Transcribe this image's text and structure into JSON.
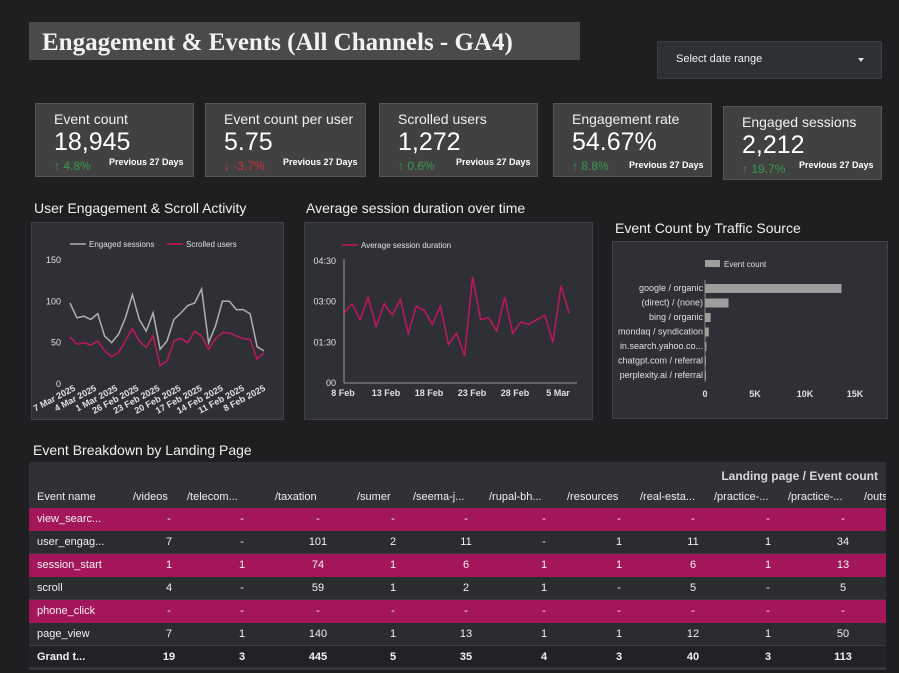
{
  "header": {
    "title": "Engagement & Events (All Channels - GA4)",
    "date_range_label": "Select date range"
  },
  "kpis": [
    {
      "label": "Event count",
      "value": "18,945",
      "delta": "4.8%",
      "direction": "up",
      "prev": "Previous 27 Days"
    },
    {
      "label": "Event count per user",
      "value": "5.75",
      "delta": "-3.7%",
      "direction": "down",
      "prev": "Previous 27 Days"
    },
    {
      "label": "Scrolled users",
      "value": "1,272",
      "delta": "0.6%",
      "direction": "up",
      "prev": "Previous 27 Days"
    },
    {
      "label": "Engagement rate",
      "value": "54.67%",
      "delta": "8.8%",
      "direction": "up",
      "prev": "Previous 27 Days"
    },
    {
      "label": "Engaged sessions",
      "value": "2,212",
      "delta": "19.7%",
      "direction": "up",
      "prev": "Previous 27 Days"
    }
  ],
  "colors": {
    "engaged": "#b0b0b0",
    "scrolled": "#c2185b",
    "up": "#3a9a4a",
    "down": "#d0303c",
    "bar": "#9e9e9e",
    "highlight_row": "#a3175a"
  },
  "chart_titles": {
    "engagement": "User Engagement & Scroll Activity",
    "duration": "Average session duration over time",
    "traffic": "Event Count by Traffic Source"
  },
  "chart_data": [
    {
      "type": "line",
      "title": "User Engagement & Scroll Activity",
      "x_tick_labels": [
        "7 Mar 2025",
        "4 Mar 2025",
        "1 Mar 2025",
        "26 Feb 2025",
        "23 Feb 2025",
        "20 Feb 2025",
        "17 Feb 2025",
        "14 Feb 2025",
        "11 Feb 2025",
        "8 Feb 2025"
      ],
      "ylim": [
        0,
        150
      ],
      "y_ticks": [
        "0",
        "50",
        "100",
        "150"
      ],
      "legend_position": "top",
      "series": [
        {
          "name": "Engaged sessions",
          "values": [
            98,
            80,
            82,
            78,
            85,
            58,
            50,
            60,
            80,
            108,
            78,
            64,
            86,
            42,
            52,
            78,
            86,
            95,
            98,
            115,
            50,
            70,
            100,
            100,
            90,
            90,
            85,
            45,
            40
          ]
        },
        {
          "name": "Scrolled users",
          "values": [
            57,
            48,
            50,
            47,
            52,
            40,
            33,
            38,
            52,
            67,
            52,
            44,
            58,
            22,
            28,
            52,
            55,
            50,
            64,
            58,
            42,
            55,
            62,
            62,
            58,
            55,
            54,
            30,
            38
          ]
        }
      ]
    },
    {
      "type": "line",
      "title": "Average session duration over time",
      "x_tick_labels": [
        "8 Feb",
        "13 Feb",
        "18 Feb",
        "23 Feb",
        "28 Feb",
        "5 Mar"
      ],
      "y_tick_labels": [
        "00",
        "01:30",
        "03:00",
        "04:30"
      ],
      "ylim_seconds": [
        0,
        270
      ],
      "legend_position": "top",
      "series": [
        {
          "name": "Average session duration",
          "values_seconds": [
            155,
            175,
            140,
            190,
            125,
            175,
            150,
            185,
            110,
            170,
            160,
            130,
            170,
            85,
            110,
            60,
            235,
            140,
            145,
            115,
            190,
            110,
            135,
            130,
            140,
            150,
            90,
            215,
            155
          ]
        }
      ]
    },
    {
      "type": "bar",
      "orientation": "horizontal",
      "title": "Event Count by Traffic Source",
      "legend": [
        "Event count"
      ],
      "categories": [
        "google / organic",
        "(direct) / (none)",
        "bing / organic",
        "mondaq / syndication",
        "in.search.yahoo.co...",
        "chatgpt.com / referral",
        "perplexity.ai / referral"
      ],
      "values": [
        14500,
        2500,
        600,
        400,
        150,
        100,
        80
      ],
      "xlim": [
        0,
        17000
      ],
      "x_ticks": [
        "0",
        "5K",
        "10K",
        "15K"
      ]
    }
  ],
  "table": {
    "title": "Event Breakdown by Landing Page",
    "header_title": "Landing page / Event count",
    "row_header": "Event name",
    "columns": [
      "/videos",
      "/telecom...",
      "/taxation",
      "/sumer",
      "/seema-j...",
      "/rupal-bh...",
      "/resources",
      "/real-esta...",
      "/practice-...",
      "/practice-...",
      "/outs"
    ],
    "rows": [
      {
        "name": "view_searc...",
        "cells": [
          "-",
          "-",
          "-",
          "-",
          "-",
          "-",
          "-",
          "-",
          "-",
          "-"
        ],
        "highlight": true
      },
      {
        "name": "user_engag...",
        "cells": [
          "7",
          "-",
          "101",
          "2",
          "11",
          "-",
          "1",
          "11",
          "1",
          "34"
        ],
        "highlight": false
      },
      {
        "name": "session_start",
        "cells": [
          "1",
          "1",
          "74",
          "1",
          "6",
          "1",
          "1",
          "6",
          "1",
          "13"
        ],
        "highlight": true
      },
      {
        "name": "scroll",
        "cells": [
          "4",
          "-",
          "59",
          "1",
          "2",
          "1",
          "-",
          "5",
          "-",
          "5"
        ],
        "highlight": false
      },
      {
        "name": "phone_click",
        "cells": [
          "-",
          "-",
          "-",
          "-",
          "-",
          "-",
          "-",
          "-",
          "-",
          "-"
        ],
        "highlight": true
      },
      {
        "name": "page_view",
        "cells": [
          "7",
          "1",
          "140",
          "1",
          "13",
          "1",
          "1",
          "12",
          "1",
          "50"
        ],
        "highlight": false
      }
    ],
    "total": {
      "name": "Grand t...",
      "cells": [
        "19",
        "3",
        "445",
        "5",
        "35",
        "4",
        "3",
        "40",
        "3",
        "113"
      ]
    }
  }
}
